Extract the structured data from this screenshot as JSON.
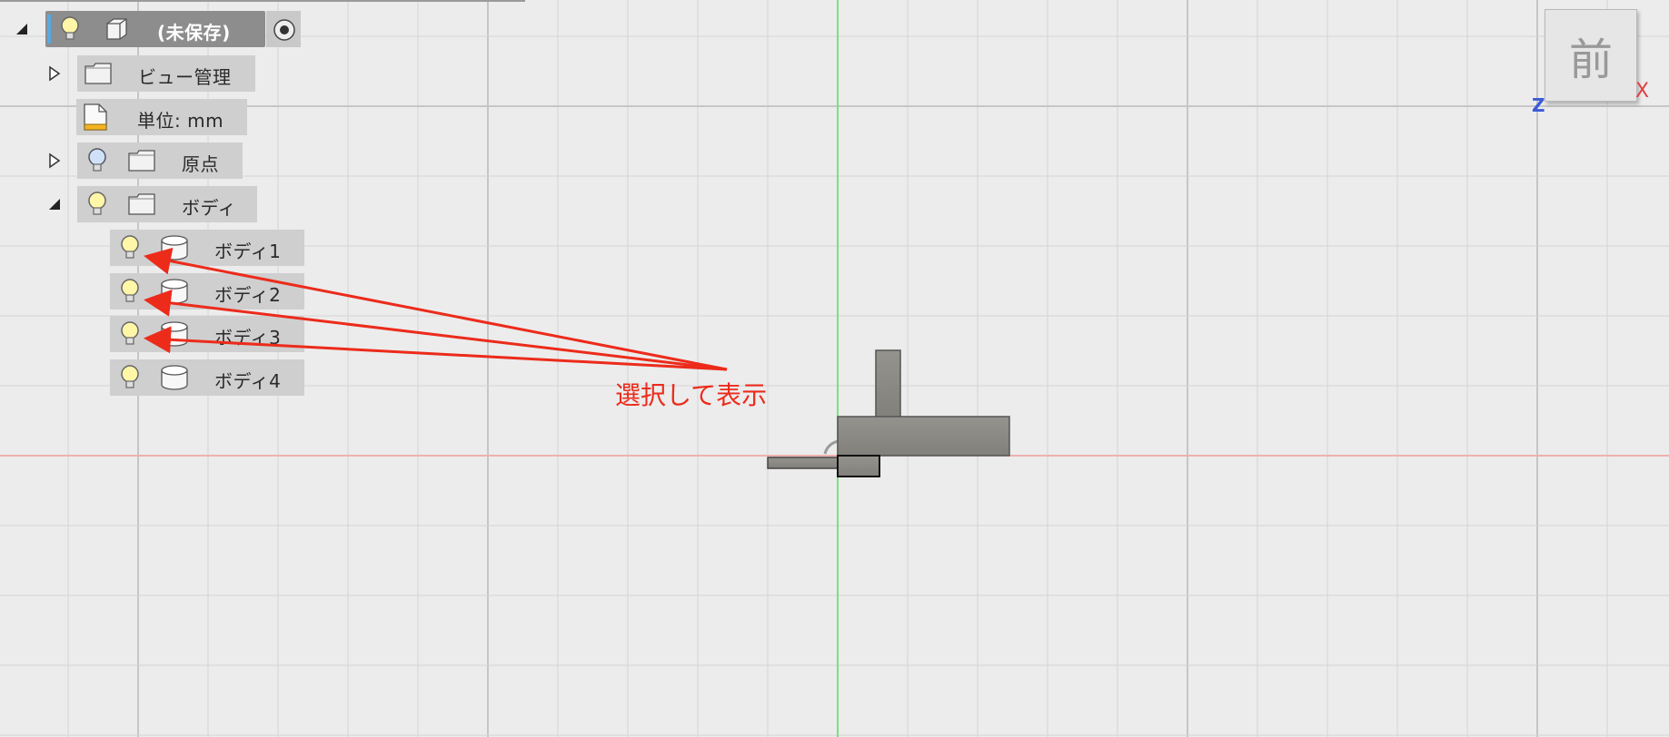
{
  "browser": {
    "root": {
      "label": "(未保存)",
      "icons": [
        "lightbulb-icon",
        "component-icon",
        "radio-target-icon"
      ]
    },
    "items": [
      {
        "label": "ビュー管理",
        "icon": "folder-icon",
        "expander": "collapsed"
      },
      {
        "label": "単位: mm",
        "icon": "document-ruler-icon"
      },
      {
        "label": "原点",
        "icon": "folder-icon",
        "visibility_icon": "lightbulb-icon",
        "expander": "collapsed"
      },
      {
        "label": "ボディ",
        "icon": "folder-icon",
        "visibility_icon": "lightbulb-icon",
        "expander": "expanded"
      }
    ],
    "bodies": [
      {
        "label": "ボディ1",
        "icon": "body-icon",
        "visibility_icon": "lightbulb-icon"
      },
      {
        "label": "ボディ2",
        "icon": "body-icon",
        "visibility_icon": "lightbulb-icon"
      },
      {
        "label": "ボディ3",
        "icon": "body-icon",
        "visibility_icon": "lightbulb-icon"
      },
      {
        "label": "ボディ4",
        "icon": "body-icon",
        "visibility_icon": "lightbulb-icon"
      }
    ]
  },
  "annotation": {
    "text": "選択して表示",
    "color": "#ec2b1b"
  },
  "viewcube": {
    "face_label": "前",
    "axis_x": "X",
    "axis_z": "Z"
  },
  "colors": {
    "background": "#ececec",
    "grid": "#d4d4d4",
    "x_axis": "#f0b0b0",
    "y_axis": "#7ee07e",
    "body": "#8c8a84",
    "arrow": "#ec2b1b"
  }
}
